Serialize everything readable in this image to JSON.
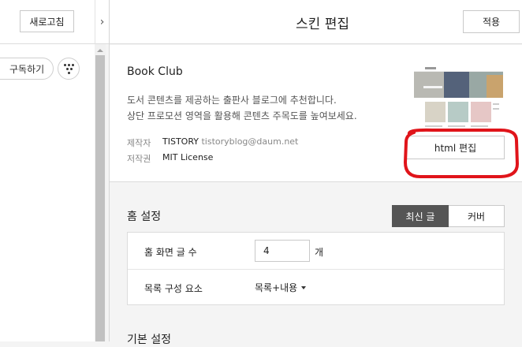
{
  "left_pane": {
    "refresh_label": "새로고침",
    "subscribe_label": "구독하기"
  },
  "header": {
    "title": "스킨 편집",
    "apply_label": "적용"
  },
  "skin": {
    "name": "Book Club",
    "description": [
      "도서 콘텐츠를 제공하는 출판사 블로그에 추천합니다.",
      "상단 프로모션 영역을 활용해 콘텐츠 주목도를 높여보세요."
    ],
    "author_label": "제작자",
    "author_name": "TISTORY",
    "author_email": "tistoryblog@daum.net",
    "license_label": "저작권",
    "license_value": "MIT License",
    "html_edit_label": "html 편집"
  },
  "home_settings": {
    "title": "홈 설정",
    "view_options": [
      "최신 글",
      "커버"
    ],
    "selected_view": "최신 글",
    "post_count_label": "홈 화면 글 수",
    "post_count_value": "4",
    "post_count_unit": "개",
    "list_elements_label": "목록 구성 요소",
    "list_elements_value": "목록+내용"
  },
  "basic_settings": {
    "title": "기본 설정"
  },
  "colors": {
    "accent_dark": "#555555",
    "highlight": "#e0141a",
    "background": "#f4f4f4"
  },
  "icons": {
    "collapse_toggle": "chevron-right-icon",
    "more_menu": "dots-menu-icon",
    "select_caret": "caret-down-icon"
  }
}
